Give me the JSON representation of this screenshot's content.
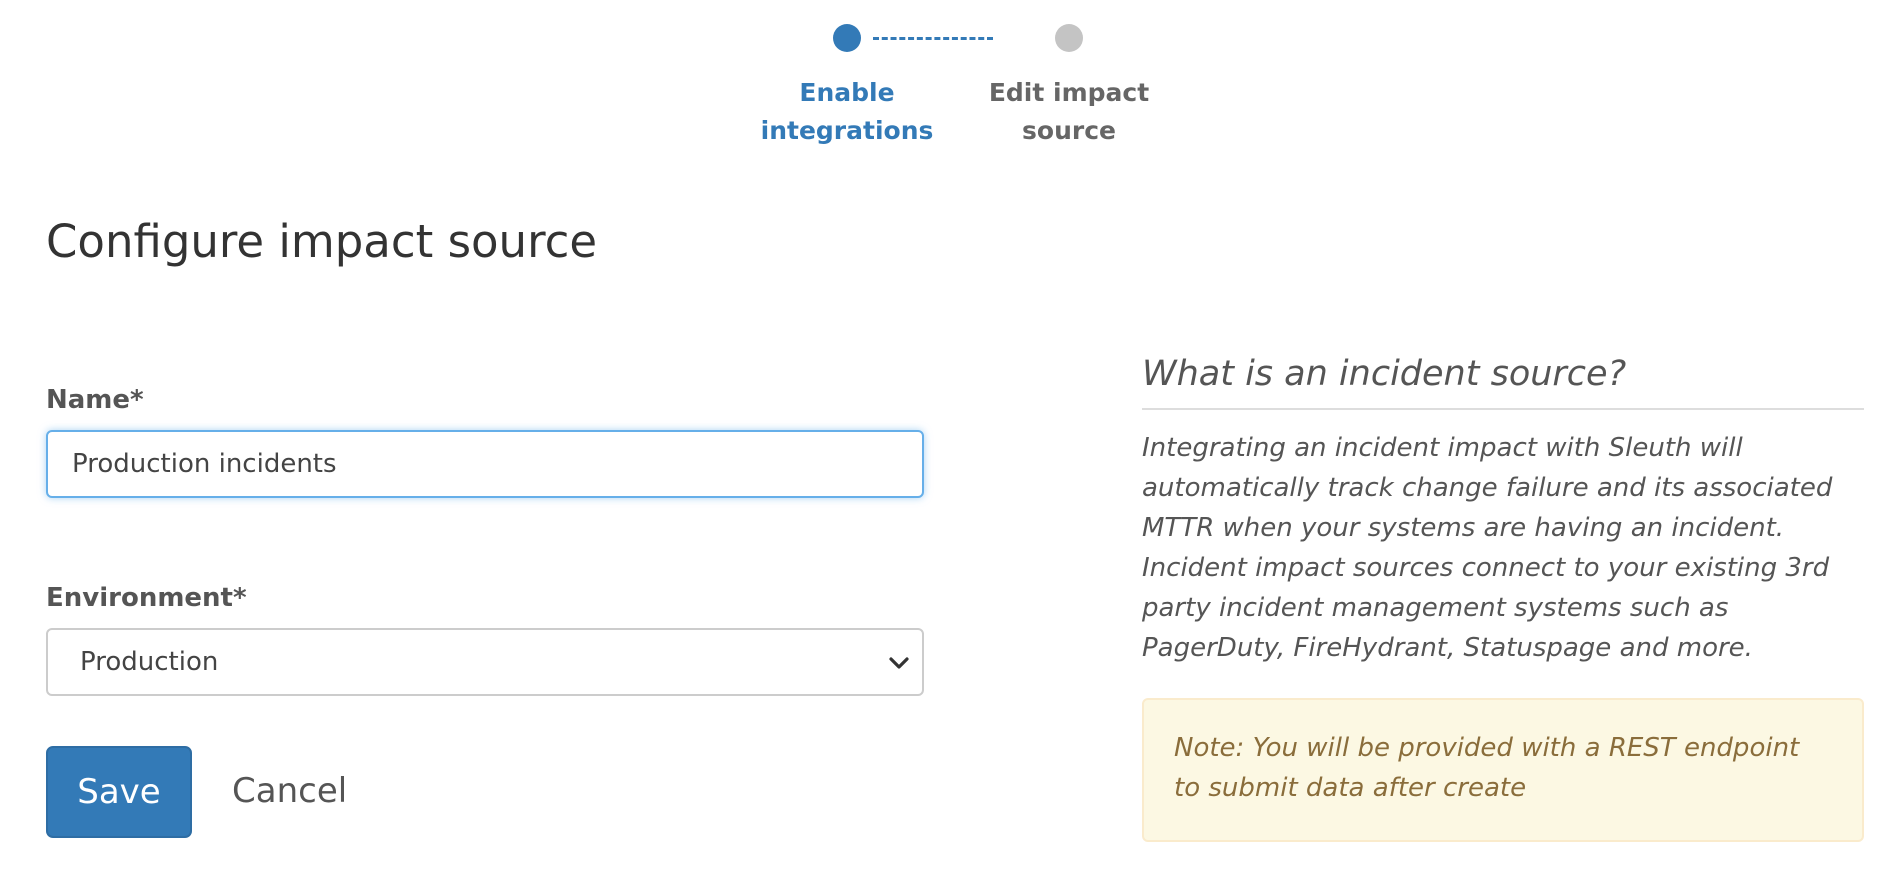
{
  "stepper": {
    "steps": [
      {
        "label": "Enable integrations",
        "state": "active"
      },
      {
        "label": "Edit impact source",
        "state": "inactive"
      }
    ]
  },
  "page": {
    "title": "Configure impact source"
  },
  "form": {
    "name_label": "Name*",
    "name_value": "Production incidents",
    "environment_label": "Environment*",
    "environment_value": "Production",
    "save_label": "Save",
    "cancel_label": "Cancel"
  },
  "help": {
    "title": "What is an incident source?",
    "body": "Integrating an incident impact with Sleuth will automatically track change failure and its associated MTTR when your systems are having an incident. Incident impact sources connect to your existing 3rd party incident management systems such as PagerDuty, FireHydrant, Statuspage and more.",
    "note": "Note: You will be provided with a REST endpoint to submit data after create"
  },
  "colors": {
    "accent": "#337ab7",
    "inactive_step": "#c4c4c4",
    "note_background": "#fcf8e3",
    "note_text": "#8a6d3b"
  },
  "icons": {
    "select_arrow": "chevron-down-icon"
  }
}
